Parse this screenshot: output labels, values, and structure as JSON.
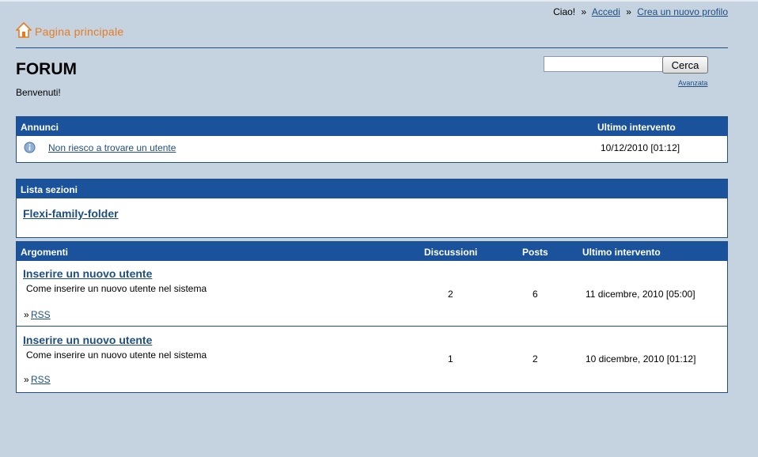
{
  "topbar": {
    "greeting": "Ciao!",
    "sep1": "»",
    "login": "Accedi",
    "sep2": "»",
    "register": "Crea un nuovo profilo"
  },
  "home": {
    "label": "Pagina principale",
    "icon": "home-icon"
  },
  "page": {
    "title": "FORUM",
    "welcome": "Benvenuti!"
  },
  "search": {
    "value": "",
    "button": "Cerca",
    "advanced": "Avanzata"
  },
  "announcements": {
    "header": "Annunci",
    "last_post_header": "Ultimo intervento",
    "items": [
      {
        "title": "Non riesco a trovare un utente",
        "last_post": "10/12/2010 [01:12]",
        "icon": "info-icon"
      }
    ]
  },
  "sections": {
    "header": "Lista sezioni",
    "items": [
      {
        "name": "Flexi-family-folder"
      }
    ]
  },
  "topics": {
    "headers": {
      "topic": "Argomenti",
      "discussions": "Discussioni",
      "posts": "Posts",
      "last_post": "Ultimo intervento"
    },
    "rows": [
      {
        "title": "Inserire un nuovo utente",
        "description": "Come inserire un nuovo utente nel sistema",
        "discussions": "2",
        "posts": "6",
        "last_post": "11 dicembre, 2010 [05:00]",
        "rss_prefix": "»",
        "rss": "RSS"
      },
      {
        "title": "Inserire un nuovo utente",
        "description": "Come inserire un nuovo utente nel sistema",
        "discussions": "1",
        "posts": "2",
        "last_post": "10 dicembre, 2010 [01:12]",
        "rss_prefix": "»",
        "rss": "RSS"
      }
    ]
  },
  "colors": {
    "background": "#c5d3e1",
    "header": "#1a539c",
    "home_accent": "#e87b1e",
    "link": "#1f4f82"
  }
}
